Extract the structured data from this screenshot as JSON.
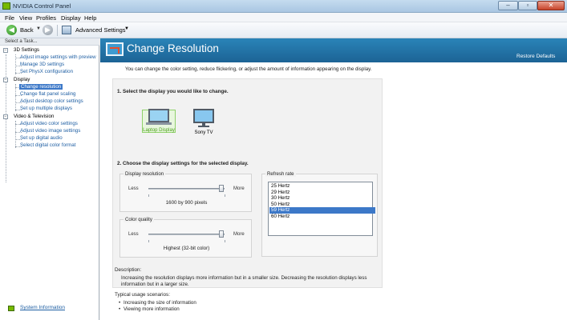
{
  "window": {
    "title": "NVIDIA Control Panel",
    "controls": {
      "minimize": "–",
      "maximize": "▫",
      "close": "✕"
    }
  },
  "menu": {
    "file": "File",
    "view": "View",
    "profiles": "Profiles",
    "display": "Display",
    "help": "Help"
  },
  "toolbar": {
    "back": "Back",
    "advanced_settings": "Advanced Settings"
  },
  "taskpane": {
    "header": "Select a Task...",
    "categories": [
      {
        "label": "3D Settings",
        "items": [
          "Adjust image settings with preview",
          "Manage 3D settings",
          "Set PhysX configuration"
        ]
      },
      {
        "label": "Display",
        "items": [
          "Change resolution",
          "Change flat panel scaling",
          "Adjust desktop color settings",
          "Set up multiple displays"
        ]
      },
      {
        "label": "Video & Television",
        "items": [
          "Adjust video color settings",
          "Adjust video image settings",
          "Set up digital audio",
          "Select digital color format"
        ]
      }
    ],
    "selected_item": "Change resolution",
    "system_information": "System Information"
  },
  "page": {
    "title": "Change Resolution",
    "restore_defaults": "Restore Defaults",
    "intro": "You can change the color setting, reduce flickering, or adjust the amount of information appearing on the display.",
    "step1": "1. Select the display you would like to change.",
    "displays": [
      "Laptop Display",
      "Sony TV"
    ],
    "selected_display": "Laptop Display",
    "step2": "2. Choose the display settings for the selected display.",
    "resolution": {
      "label": "Display resolution",
      "less": "Less",
      "more": "More",
      "value": "1600 by 900 pixels",
      "level": 0.97
    },
    "color_quality": {
      "label": "Color quality",
      "less": "Less",
      "more": "More",
      "value": "Highest (32-bit color)",
      "level": 0.97
    },
    "refresh_rate": {
      "label": "Refresh rate",
      "options": [
        "25 Hertz",
        "29 Hertz",
        "30 Hertz",
        "50 Hertz",
        "59 Hertz",
        "60 Hertz"
      ],
      "selected": "59 Hertz"
    },
    "description_label": "Description:",
    "description": "Increasing the resolution displays more information but in a smaller size. Decreasing the resolution displays less information but in a larger size.",
    "usage_label": "Typical usage scenarios:",
    "usage": [
      "Increasing the size of information",
      "Viewing more information"
    ]
  },
  "colors": {
    "header_blue": "#1f6ea1",
    "selection_blue": "#3c78c8",
    "nvidia_green": "#76b900",
    "link_blue": "#1f5fa3"
  }
}
